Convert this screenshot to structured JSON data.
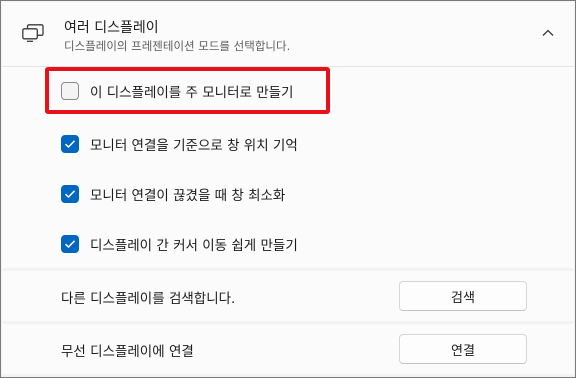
{
  "section": {
    "title": "여러 디스플레이",
    "subtitle": "디스플레이의 프레젠테이션 모드를 선택합니다."
  },
  "options": [
    {
      "label": "이 디스플레이를 주 모니터로 만들기",
      "checked": false,
      "highlighted": true
    },
    {
      "label": "모니터 연결을 기준으로 창 위치 기억",
      "checked": true
    },
    {
      "label": "모니터 연결이 끊겼을 때 창 최소화",
      "checked": true
    },
    {
      "label": "디스플레이 간 커서 이동 쉽게 만들기",
      "checked": true
    }
  ],
  "detect": {
    "label": "다른 디스플레이를 검색합니다.",
    "button": "검색"
  },
  "wireless": {
    "label": "무선 디스플레이에 연결",
    "button": "연결"
  },
  "colors": {
    "accent": "#0067c0",
    "highlight_border": "#e8101a"
  },
  "icons": {
    "section": "multiple-monitors-icon",
    "collapse": "chevron-up-icon",
    "check": "checkmark-icon"
  }
}
